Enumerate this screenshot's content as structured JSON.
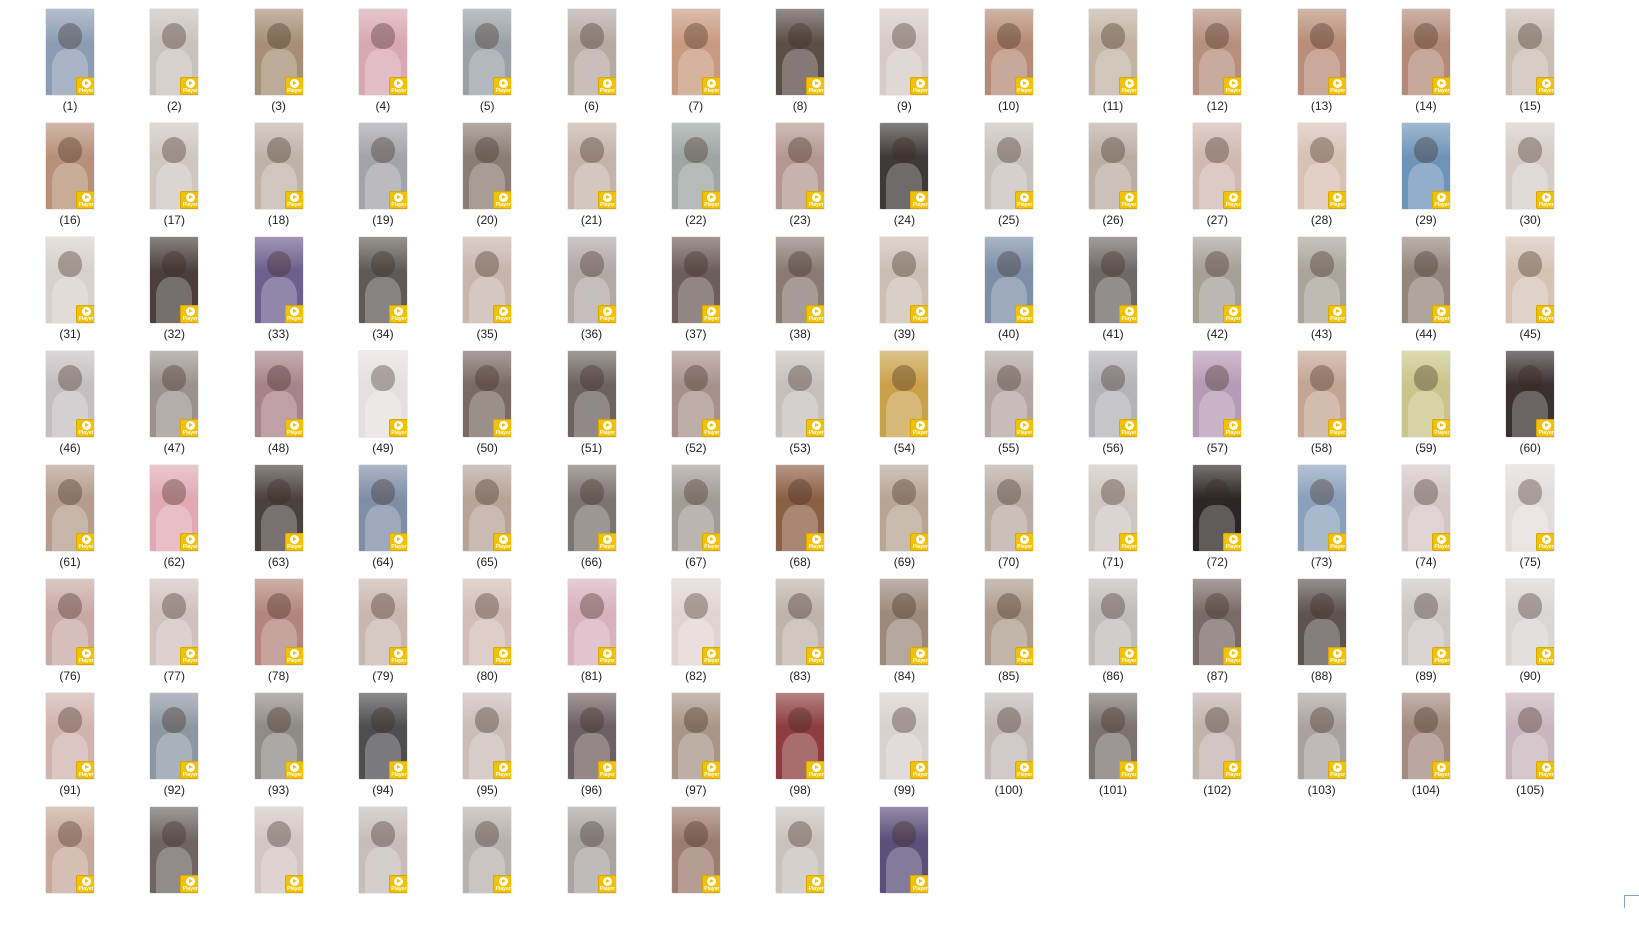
{
  "badge_label": "Player",
  "badge_color": "#f2c200",
  "icons": {
    "play": "play-icon"
  },
  "thumbnails": [
    {
      "caption": "(1)",
      "tone": "#8c9db3"
    },
    {
      "caption": "(2)",
      "tone": "#c9c2bd"
    },
    {
      "caption": "(3)",
      "tone": "#a68f76"
    },
    {
      "caption": "(4)",
      "tone": "#d9a7b4"
    },
    {
      "caption": "(5)",
      "tone": "#9aa1a8"
    },
    {
      "caption": "(6)",
      "tone": "#b7aaa3"
    },
    {
      "caption": "(7)",
      "tone": "#c99a7f"
    },
    {
      "caption": "(8)",
      "tone": "#5b4d47"
    },
    {
      "caption": "(9)",
      "tone": "#d6cbc7"
    },
    {
      "caption": "(10)",
      "tone": "#b68b76"
    },
    {
      "caption": "(11)",
      "tone": "#c2b3a3"
    },
    {
      "caption": "(12)",
      "tone": "#b78f7d"
    },
    {
      "caption": "(13)",
      "tone": "#b88d79"
    },
    {
      "caption": "(14)",
      "tone": "#b38a77"
    },
    {
      "caption": "(15)",
      "tone": "#c9bdb2"
    },
    {
      "caption": "(16)",
      "tone": "#b8907a"
    },
    {
      "caption": "(17)",
      "tone": "#cfc6bf"
    },
    {
      "caption": "(18)",
      "tone": "#bfb3a8"
    },
    {
      "caption": "(19)",
      "tone": "#a3a3aa"
    },
    {
      "caption": "(20)",
      "tone": "#8a7d73"
    },
    {
      "caption": "(21)",
      "tone": "#c4b4a8"
    },
    {
      "caption": "(22)",
      "tone": "#9ea5a3"
    },
    {
      "caption": "(23)",
      "tone": "#b49890"
    },
    {
      "caption": "(24)",
      "tone": "#3f3a3a"
    },
    {
      "caption": "(25)",
      "tone": "#c7c1bb"
    },
    {
      "caption": "(26)",
      "tone": "#bcaea3"
    },
    {
      "caption": "(27)",
      "tone": "#d1b8b0"
    },
    {
      "caption": "(28)",
      "tone": "#d8c1b5"
    },
    {
      "caption": "(29)",
      "tone": "#6e93b8"
    },
    {
      "caption": "(30)",
      "tone": "#d6ccc6"
    },
    {
      "caption": "(31)",
      "tone": "#d8d0cc"
    },
    {
      "caption": "(32)",
      "tone": "#4a3f3d"
    },
    {
      "caption": "(33)",
      "tone": "#6d5f8e"
    },
    {
      "caption": "(34)",
      "tone": "#5e5a57"
    },
    {
      "caption": "(35)",
      "tone": "#c8b5ab"
    },
    {
      "caption": "(36)",
      "tone": "#b3a7a8"
    },
    {
      "caption": "(37)",
      "tone": "#6d5e5b"
    },
    {
      "caption": "(38)",
      "tone": "#8a7a74"
    },
    {
      "caption": "(39)",
      "tone": "#cbbfb3"
    },
    {
      "caption": "(40)",
      "tone": "#7c8ea8"
    },
    {
      "caption": "(41)",
      "tone": "#6f6868"
    },
    {
      "caption": "(42)",
      "tone": "#a69f96"
    },
    {
      "caption": "(43)",
      "tone": "#aaa49a"
    },
    {
      "caption": "(44)",
      "tone": "#93877d"
    },
    {
      "caption": "(45)",
      "tone": "#d6c3b6"
    },
    {
      "caption": "(46)",
      "tone": "#c6bfc2"
    },
    {
      "caption": "(47)",
      "tone": "#9c928d"
    },
    {
      "caption": "(48)",
      "tone": "#a8828a"
    },
    {
      "caption": "(49)",
      "tone": "#e4e0df"
    },
    {
      "caption": "(50)",
      "tone": "#7a6a63"
    },
    {
      "caption": "(51)",
      "tone": "#6c625f"
    },
    {
      "caption": "(52)",
      "tone": "#a8918b"
    },
    {
      "caption": "(53)",
      "tone": "#c6c0bd"
    },
    {
      "caption": "(54)",
      "tone": "#c9a14a"
    },
    {
      "caption": "(55)",
      "tone": "#b3a6a2"
    },
    {
      "caption": "(56)",
      "tone": "#b3b3b8"
    },
    {
      "caption": "(57)",
      "tone": "#b79ab5"
    },
    {
      "caption": "(58)",
      "tone": "#c4a493"
    },
    {
      "caption": "(59)",
      "tone": "#c9c58a"
    },
    {
      "caption": "(60)",
      "tone": "#3a3031"
    },
    {
      "caption": "(61)",
      "tone": "#b59c8c"
    },
    {
      "caption": "(62)",
      "tone": "#e0a9b4"
    },
    {
      "caption": "(63)",
      "tone": "#4b423f"
    },
    {
      "caption": "(64)",
      "tone": "#7e8ea6"
    },
    {
      "caption": "(65)",
      "tone": "#b8a398"
    },
    {
      "caption": "(66)",
      "tone": "#7c7471"
    },
    {
      "caption": "(67)",
      "tone": "#a39c94"
    },
    {
      "caption": "(68)",
      "tone": "#8c5f45"
    },
    {
      "caption": "(69)",
      "tone": "#b9a495"
    },
    {
      "caption": "(70)",
      "tone": "#b7aba2"
    },
    {
      "caption": "(71)",
      "tone": "#cfc6c0"
    },
    {
      "caption": "(72)",
      "tone": "#2b2625"
    },
    {
      "caption": "(73)",
      "tone": "#8ba0bc"
    },
    {
      "caption": "(74)",
      "tone": "#d3c6c7"
    },
    {
      "caption": "(75)",
      "tone": "#e3dbdb"
    },
    {
      "caption": "(76)",
      "tone": "#c9a9a5"
    },
    {
      "caption": "(77)",
      "tone": "#d0c2bd"
    },
    {
      "caption": "(78)",
      "tone": "#b3857b"
    },
    {
      "caption": "(79)",
      "tone": "#c9b6ae"
    },
    {
      "caption": "(80)",
      "tone": "#d4bdb7"
    },
    {
      "caption": "(81)",
      "tone": "#d7b1bd"
    },
    {
      "caption": "(82)",
      "tone": "#e0d4d3"
    },
    {
      "caption": "(83)",
      "tone": "#bfb3ab"
    },
    {
      "caption": "(84)",
      "tone": "#9c8a7c"
    },
    {
      "caption": "(85)",
      "tone": "#ad9b8c"
    },
    {
      "caption": "(86)",
      "tone": "#c1bcbc"
    },
    {
      "caption": "(87)",
      "tone": "#7a6a66"
    },
    {
      "caption": "(88)",
      "tone": "#5d5350"
    },
    {
      "caption": "(89)",
      "tone": "#ccc6c4"
    },
    {
      "caption": "(90)",
      "tone": "#d9d6d4"
    },
    {
      "caption": "(91)",
      "tone": "#d1b3ad"
    },
    {
      "caption": "(92)",
      "tone": "#8d97a2"
    },
    {
      "caption": "(93)",
      "tone": "#8f8b87"
    },
    {
      "caption": "(94)",
      "tone": "#4e4d4f"
    },
    {
      "caption": "(95)",
      "tone": "#c9bdb6"
    },
    {
      "caption": "(96)",
      "tone": "#6e5f62"
    },
    {
      "caption": "(97)",
      "tone": "#a89587"
    },
    {
      "caption": "(98)",
      "tone": "#8e3d3f"
    },
    {
      "caption": "(99)",
      "tone": "#d7d1cf"
    },
    {
      "caption": "(100)",
      "tone": "#c2b9b7"
    },
    {
      "caption": "(101)",
      "tone": "#7c7370"
    },
    {
      "caption": "(102)",
      "tone": "#c1b2ab"
    },
    {
      "caption": "(103)",
      "tone": "#aaa2a0"
    },
    {
      "caption": "(104)",
      "tone": "#a48a80"
    },
    {
      "caption": "(105)",
      "tone": "#c9b5bd"
    },
    {
      "caption": "",
      "tone": "#c7a89a"
    },
    {
      "caption": "",
      "tone": "#6d6463"
    },
    {
      "caption": "",
      "tone": "#d2c6c3"
    },
    {
      "caption": "",
      "tone": "#c7bcb8"
    },
    {
      "caption": "",
      "tone": "#b8b2ae"
    },
    {
      "caption": "",
      "tone": "#a9a4a2"
    },
    {
      "caption": "",
      "tone": "#9c7c70"
    },
    {
      "caption": "",
      "tone": "#c9c1bc"
    },
    {
      "caption": "",
      "tone": "#5a4f7a"
    }
  ]
}
